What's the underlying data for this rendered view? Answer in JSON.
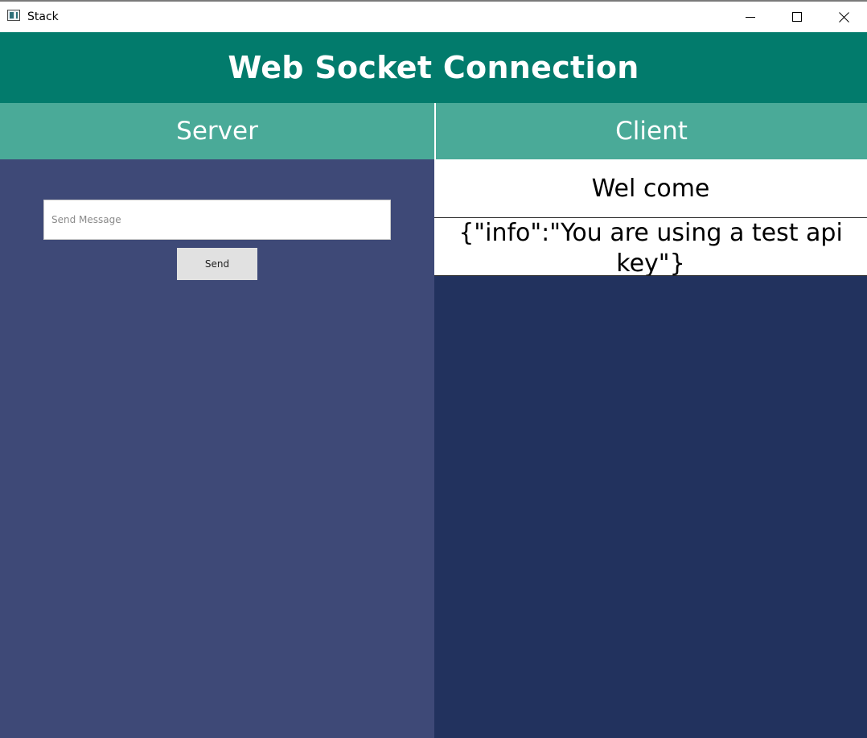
{
  "window": {
    "title": "Stack",
    "icons": {
      "app": "app-window-icon",
      "minimize": "minimize-icon",
      "maximize": "maximize-icon",
      "close": "close-icon"
    }
  },
  "header": {
    "title": "Web Socket Connection"
  },
  "server": {
    "label": "Server",
    "input": {
      "placeholder": "Send Message",
      "value": ""
    },
    "send_label": "Send"
  },
  "client": {
    "label": "Client",
    "messages": [
      "Wel come",
      "{\"info\":\"You are using a test api key\"}"
    ]
  },
  "colors": {
    "header_bg": "#027b6c",
    "panel_header_bg": "#4aaa98",
    "server_bg": "#3e4977",
    "client_bg": "#22325e",
    "message_bg": "#ffffff",
    "send_button_bg": "#e1e1e1"
  }
}
